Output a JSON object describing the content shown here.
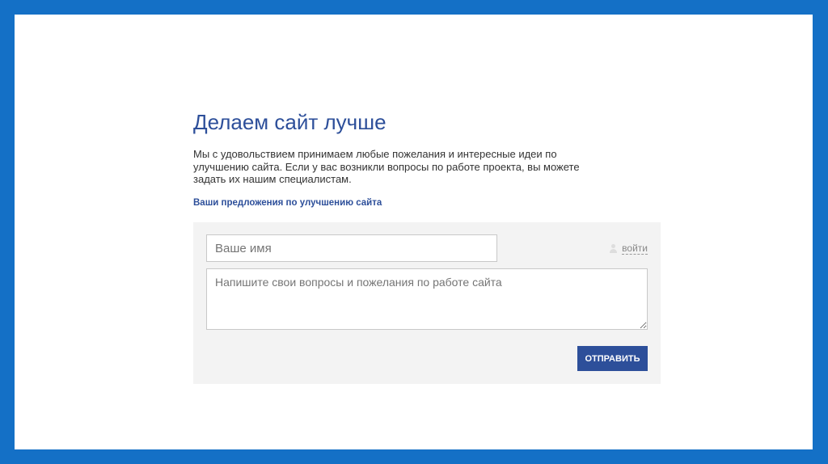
{
  "title": "Делаем сайт лучше",
  "description": "Мы с удовольствием принимаем любые пожелания и интересные идеи по улучшению сайта. Если у вас возникли вопросы по работе проекта, вы можете задать их нашим специалистам.",
  "subtitle": "Ваши предложения по улучшению сайта",
  "form": {
    "name_placeholder": "Ваше имя",
    "message_placeholder": "Напишите свои вопросы и пожелания по работе сайта",
    "login_label": "войти",
    "submit_label": "ОТПРАВИТЬ"
  },
  "colors": {
    "frame": "#1470c6",
    "accent": "#2d4f9a"
  }
}
